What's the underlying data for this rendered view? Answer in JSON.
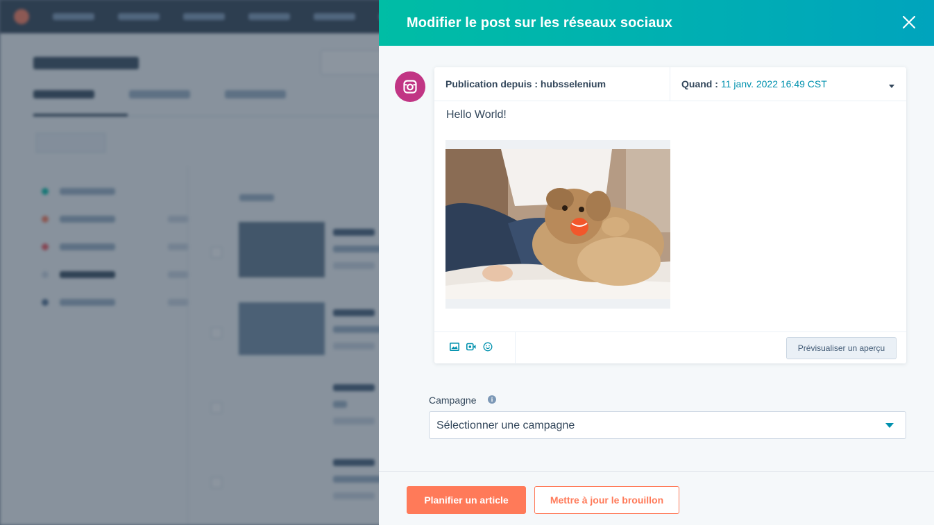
{
  "panel": {
    "title": "Modifier le post sur les réseaux sociaux"
  },
  "composer": {
    "network_icon": "instagram-icon",
    "publish_from": "Publication depuis : hubsselenium",
    "when_label": "Quand :",
    "when_value": "11 janv. 2022 16:49 CST",
    "body_text": "Hello World!",
    "image_alt": "dog-with-ball-photo",
    "tools": [
      "image-icon",
      "video-icon",
      "emoji-icon"
    ],
    "preview_label": "Prévisualiser un aperçu"
  },
  "campaign": {
    "label": "Campagne",
    "select_value": "Sélectionner une campagne"
  },
  "footer": {
    "primary_label": "Planifier un article",
    "secondary_label": "Mettre à jour le brouillon"
  },
  "colors": {
    "header_gradient_start": "#00bda5",
    "header_gradient_end": "#00a4bd",
    "accent_orange": "#ff7a59",
    "link_teal": "#0091ae",
    "instagram": "#c13584"
  }
}
